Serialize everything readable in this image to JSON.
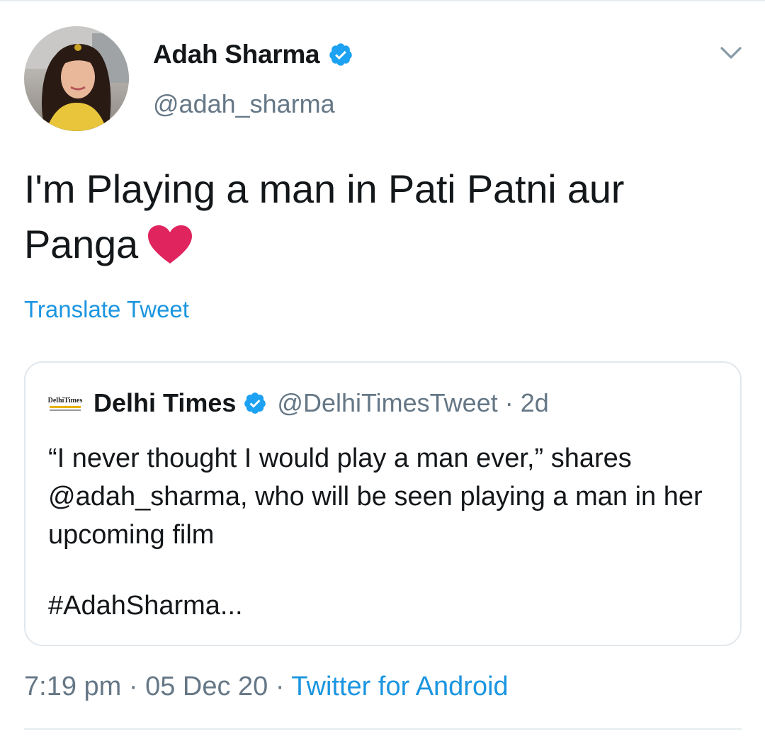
{
  "author": {
    "display_name": "Adah Sharma",
    "handle": "@adah_sharma",
    "verified_icon": "verified-badge-icon"
  },
  "tweet": {
    "text": "I'm Playing a man in Pati Patni aur Panga",
    "emoji": "red-heart-icon",
    "translate_label": "Translate Tweet"
  },
  "quoted_tweet": {
    "logo_text": "DelhiTimes",
    "display_name": "Delhi Times",
    "handle": "@DelhiTimesTweet",
    "separator": "·",
    "time": "2d",
    "text": "“I never thought I would play a man ever,” shares @adah_sharma, who will be seen playing a man in her upcoming film",
    "hashtag": "#AdahSharma..."
  },
  "meta": {
    "time": "7:19 pm",
    "sep1": " · ",
    "date": "05 Dec 20",
    "sep2": " · ",
    "source": "Twitter for Android"
  },
  "colors": {
    "link": "#1b95e0",
    "secondary": "#657786",
    "heart": "#e0245e",
    "border": "#e1e8ed"
  }
}
